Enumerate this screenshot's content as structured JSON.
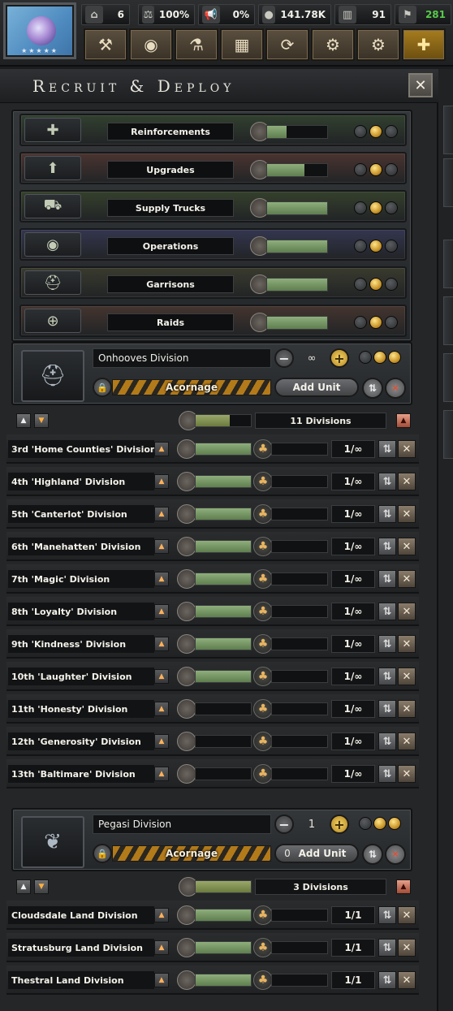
{
  "topbar": {
    "resources": [
      {
        "icon": "factory-icon",
        "glyph": "⌂",
        "value": "6"
      },
      {
        "icon": "stability-scales-icon",
        "glyph": "⚖",
        "value": "100%"
      },
      {
        "icon": "war-support-megaphone-icon",
        "glyph": "📢",
        "value": "0%"
      },
      {
        "icon": "manpower-icon",
        "glyph": "●",
        "value": "141.78K"
      },
      {
        "icon": "civilian-factory-icon",
        "glyph": "▥",
        "value": "91"
      },
      {
        "icon": "political-power-icon",
        "glyph": "⚑",
        "value": "281",
        "color": "#57c94a"
      }
    ],
    "buttons": [
      {
        "name": "decisions-hammer-button",
        "glyph": "⚒"
      },
      {
        "name": "intelligence-eye-button",
        "glyph": "◉"
      },
      {
        "name": "research-button",
        "glyph": "⚗"
      },
      {
        "name": "production-button",
        "glyph": "▦"
      },
      {
        "name": "trade-button",
        "glyph": "⟳"
      },
      {
        "name": "construction-button",
        "glyph": "⚙"
      },
      {
        "name": "settings-gear-button",
        "glyph": "⚙"
      },
      {
        "name": "deploy-button",
        "glyph": "✚",
        "accent": true
      }
    ]
  },
  "panel": {
    "title": "Recruit & Deploy"
  },
  "categories": [
    {
      "name": "reinforcements",
      "label": "Reinforcements",
      "icon": "reinforcements-icon",
      "glyph": "✚",
      "fill": 0.32,
      "dots": [
        false,
        true,
        false
      ],
      "bg": "#31402f"
    },
    {
      "name": "upgrades",
      "label": "Upgrades",
      "icon": "upgrades-icon",
      "glyph": "⬆",
      "fill": 0.62,
      "dots": [
        false,
        true,
        false
      ],
      "bg": "#4a3430"
    },
    {
      "name": "supply-trucks",
      "label": "Supply Trucks",
      "icon": "supply-trucks-icon",
      "glyph": "⛟",
      "fill": 1.0,
      "dots": [
        false,
        true,
        false
      ],
      "bg": "#35402c"
    },
    {
      "name": "operations",
      "label": "Operations",
      "icon": "operations-eye-icon",
      "glyph": "◉",
      "fill": 1.0,
      "dots": [
        false,
        true,
        false
      ],
      "bg": "#343650"
    },
    {
      "name": "garrisons",
      "label": "Garrisons",
      "icon": "garrisons-helmet-icon",
      "glyph": "⛑",
      "fill": 1.0,
      "dots": [
        false,
        true,
        false
      ],
      "bg": "#393b2e"
    },
    {
      "name": "raids",
      "label": "Raids",
      "icon": "raids-crosshair-icon",
      "glyph": "⊕",
      "fill": 1.0,
      "dots": [
        false,
        true,
        false
      ],
      "bg": "#44352f"
    }
  ],
  "groups": [
    {
      "template": {
        "name": "Onhooves Division",
        "count": "∞",
        "equipment": "Acornage",
        "add_count": "",
        "add_label": "Add Unit",
        "portrait_icon": "infantry-helmet-icon",
        "portrait_glyph": "⛑",
        "dots": [
          false,
          true,
          true
        ]
      },
      "summary": {
        "count_label": "11 Divisions",
        "fill": 0.62
      },
      "divisions": [
        {
          "name": "3rd 'Home Counties' Division",
          "ratio": "1/∞",
          "fill": 1.0
        },
        {
          "name": "4th 'Highland' Division",
          "ratio": "1/∞",
          "fill": 1.0
        },
        {
          "name": "5th 'Canterlot' Division",
          "ratio": "1/∞",
          "fill": 1.0
        },
        {
          "name": "6th 'Manehatten' Division",
          "ratio": "1/∞",
          "fill": 1.0
        },
        {
          "name": "7th 'Magic' Division",
          "ratio": "1/∞",
          "fill": 1.0
        },
        {
          "name": "8th 'Loyalty' Division",
          "ratio": "1/∞",
          "fill": 1.0
        },
        {
          "name": "9th 'Kindness' Division",
          "ratio": "1/∞",
          "fill": 1.0
        },
        {
          "name": "10th 'Laughter' Division",
          "ratio": "1/∞",
          "fill": 1.0
        },
        {
          "name": "11th 'Honesty' Division",
          "ratio": "1/∞",
          "fill": 0.0
        },
        {
          "name": "12th 'Generosity' Division",
          "ratio": "1/∞",
          "fill": 0.0
        },
        {
          "name": "13th 'Baltimare' Division",
          "ratio": "1/∞",
          "fill": 0.0
        }
      ]
    },
    {
      "template": {
        "name": "Pegasi Division",
        "count": "1",
        "equipment": "Acornage",
        "add_count": "0",
        "add_label": "Add Unit",
        "portrait_icon": "pegasus-wings-icon",
        "portrait_glyph": "❦",
        "dots": [
          false,
          true,
          true
        ]
      },
      "summary": {
        "count_label": "3 Divisions",
        "fill": 1.0
      },
      "divisions": [
        {
          "name": "Cloudsdale Land Division",
          "ratio": "1/1",
          "fill": 1.0
        },
        {
          "name": "Stratusburg Land Division",
          "ratio": "1/1",
          "fill": 1.0
        },
        {
          "name": "Thestral Land Division",
          "ratio": "1/1",
          "fill": 1.0
        }
      ]
    }
  ]
}
